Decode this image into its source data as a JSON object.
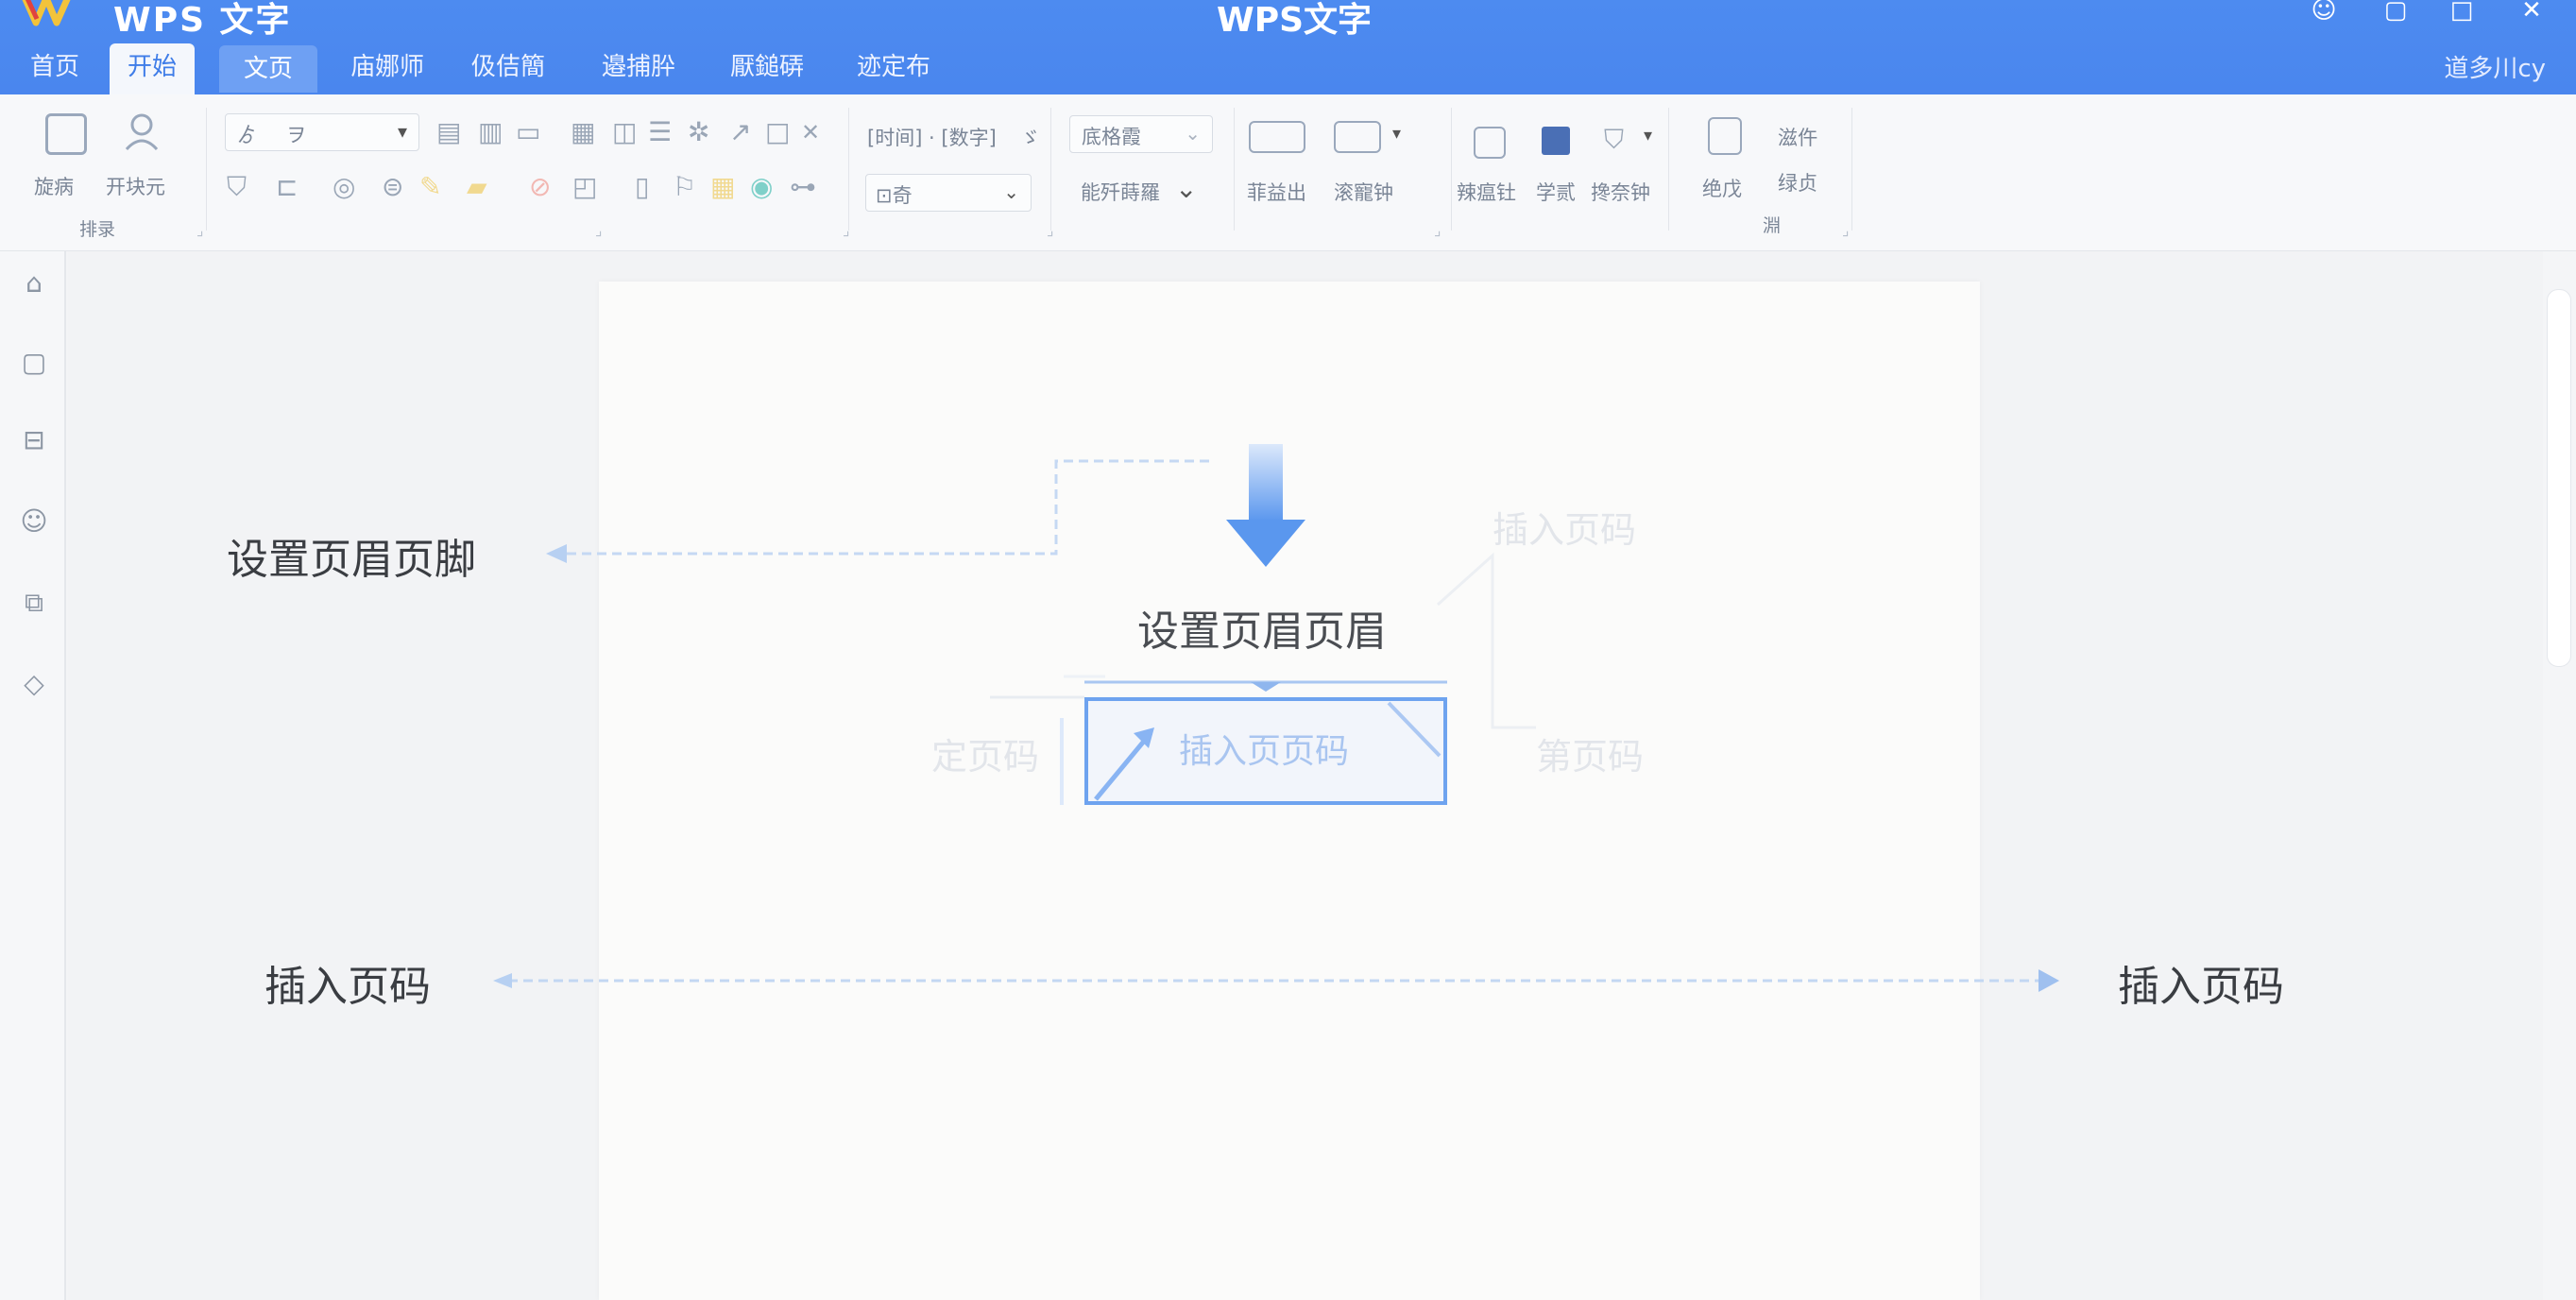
{
  "titlebar": {
    "app_name": "WPS 文字",
    "window_title": "WPS文字",
    "user_name": "道多川cy",
    "controls": [
      "☺",
      "▢",
      "□",
      "✕"
    ]
  },
  "tabs": [
    "首页",
    "开始",
    "文页",
    "庙娜师",
    "伋佶簡",
    "邉捕肸",
    "厭鎚硦",
    "迹定布"
  ],
  "ribbon": {
    "clipboard": {
      "paste_label": "旋病",
      "format_painter_label": "开块元",
      "group_label": "排录"
    },
    "font": {
      "name": "ゟ",
      "size": "ヲ"
    },
    "paragraph": {
      "line1": "[时间] · [数字]",
      "line1_tail": "ゞ",
      "dropdown": "⊡奇"
    },
    "styles": {
      "style_box": "底格霞",
      "style_box2": "能歼蒔羅"
    },
    "insert": {
      "item1": "菲益出",
      "item2": "滚寵钟"
    },
    "tools": {
      "item1": "辣瘟钍",
      "item2": "学贰",
      "item3": "搀奈钟"
    },
    "edit": {
      "item1": "绝戊",
      "item2": "滋仵",
      "item3": "绿贞",
      "group_label": "淵"
    }
  },
  "annotations": {
    "left_top": "设置页眉页脚",
    "center_title": "设置页眉页眉",
    "center_box": "插入页页码",
    "faint_right_top": "插入页码",
    "faint_left_mid": "定页码",
    "faint_right_mid": "第页码",
    "left_bottom": "插入页码",
    "right_bottom": "插入页码"
  },
  "colors": {
    "accent": "#4a86ee",
    "arrow": "#5a97ee",
    "guide_line": "#b7d0f2"
  }
}
